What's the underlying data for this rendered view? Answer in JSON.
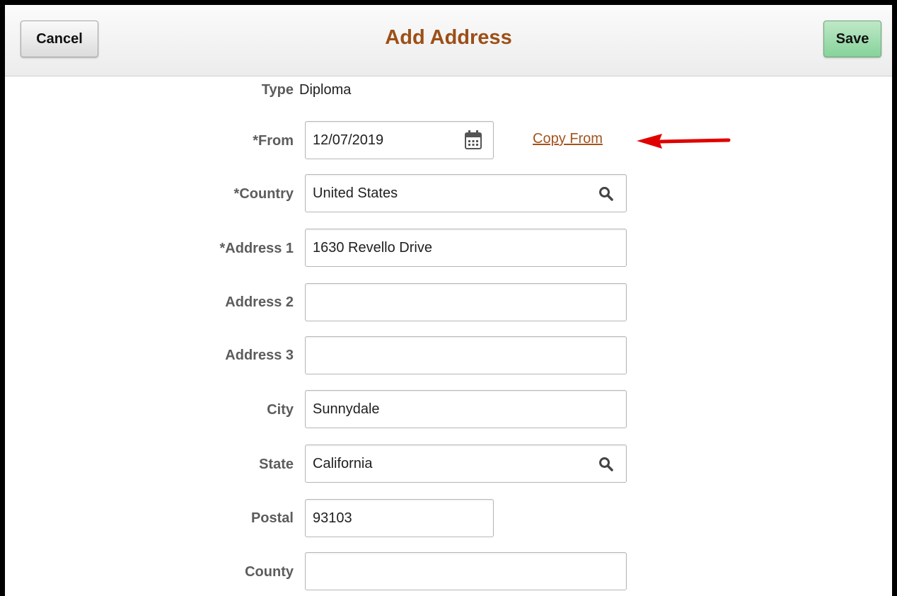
{
  "header": {
    "title": "Add Address",
    "cancel_label": "Cancel",
    "save_label": "Save"
  },
  "form": {
    "type": {
      "label": "Type",
      "value": "Diploma"
    },
    "from": {
      "label": "*From",
      "value": "12/07/2019",
      "icon": "calendar-icon"
    },
    "copy_from": {
      "label": "Copy From"
    },
    "country": {
      "label": "*Country",
      "value": "United States",
      "icon": "search-icon"
    },
    "address1": {
      "label": "*Address 1",
      "value": "1630 Revello Drive"
    },
    "address2": {
      "label": "Address 2",
      "value": ""
    },
    "address3": {
      "label": "Address 3",
      "value": ""
    },
    "city": {
      "label": "City",
      "value": "Sunnydale"
    },
    "state": {
      "label": "State",
      "value": "California",
      "icon": "search-icon"
    },
    "postal": {
      "label": "Postal",
      "value": "93103"
    },
    "county": {
      "label": "County",
      "value": ""
    }
  },
  "colors": {
    "title": "#9c4f17",
    "link": "#a2541e",
    "save_button": "#86d39a",
    "annotation_arrow": "#e00000"
  }
}
